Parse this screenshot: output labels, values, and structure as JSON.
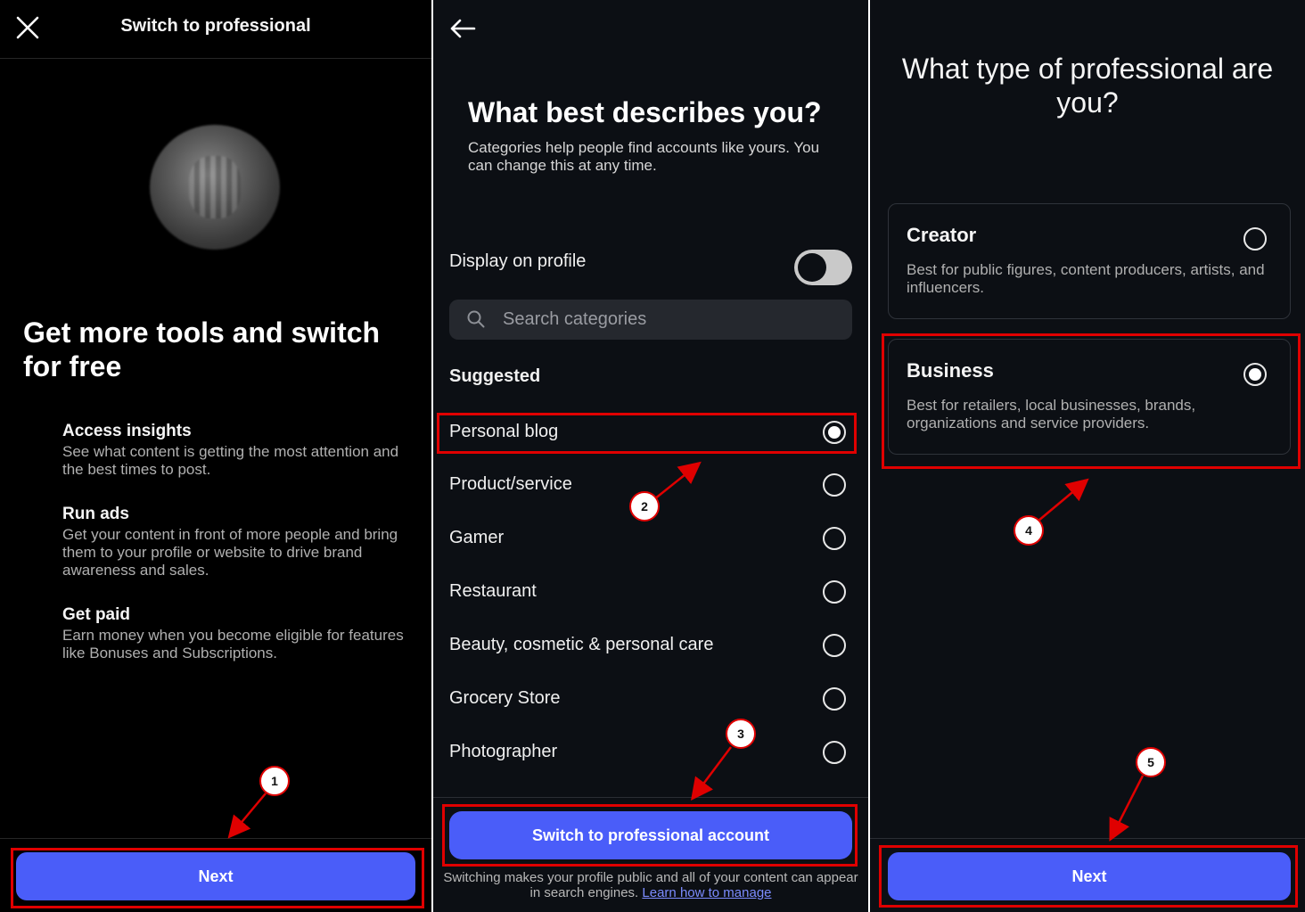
{
  "screen1": {
    "title": "Switch to professional",
    "headline": "Get more tools and switch for free",
    "features": [
      {
        "title": "Access insights",
        "description": "See what content is getting the most attention and the best times to post."
      },
      {
        "title": "Run ads",
        "description": "Get your content in front of more people and bring them to your profile or website to drive brand awareness and sales."
      },
      {
        "title": "Get paid",
        "description": "Earn money when you become eligible for features like Bonuses and Subscriptions."
      }
    ],
    "next_label": "Next"
  },
  "screen2": {
    "title": "What best describes you?",
    "subtitle": "Categories help people find accounts like yours. You can change this at any time.",
    "display_on_profile_label": "Display on profile",
    "display_on_profile_on": false,
    "search_placeholder": "Search categories",
    "suggested_label": "Suggested",
    "categories": [
      {
        "label": "Personal blog",
        "selected": true
      },
      {
        "label": "Product/service",
        "selected": false
      },
      {
        "label": "Gamer",
        "selected": false
      },
      {
        "label": "Restaurant",
        "selected": false
      },
      {
        "label": "Beauty, cosmetic & personal care",
        "selected": false
      },
      {
        "label": "Grocery Store",
        "selected": false
      },
      {
        "label": "Photographer",
        "selected": false
      }
    ],
    "switch_button_label": "Switch to professional account",
    "disclaimer": "Switching makes your profile public and all of your content can appear in search engines.",
    "learn_link": "Learn how to manage"
  },
  "screen3": {
    "title": "What type of professional are you?",
    "options": [
      {
        "title": "Creator",
        "description": "Best for public figures, content producers, artists, and influencers.",
        "selected": false
      },
      {
        "title": "Business",
        "description": "Best for retailers, local businesses, brands, organizations and service providers.",
        "selected": true
      }
    ],
    "next_label": "Next"
  },
  "annotations": {
    "steps": [
      "1",
      "2",
      "3",
      "4",
      "5"
    ],
    "color": "#e00000"
  },
  "colors": {
    "accent": "#4a5df9",
    "panel_bg_1": "#000000",
    "panel_bg_2": "#0c0f14"
  }
}
